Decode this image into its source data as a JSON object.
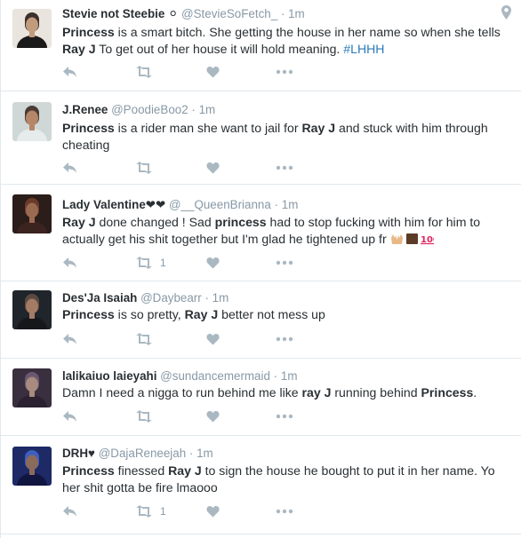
{
  "tweets": [
    {
      "name": "Stevie not Steebie ⚪",
      "handle": "@StevieSoFetch_",
      "dot": "·",
      "time": "1m",
      "segments": [
        {
          "t": "Princess",
          "b": true
        },
        {
          "t": " is a smart bitch. She getting the house in her name so when she tells "
        },
        {
          "t": "Ray J",
          "b": true
        },
        {
          "t": " To get out of her house it will hold meaning. "
        },
        {
          "t": "#LHHH",
          "h": true
        }
      ],
      "retweets": "",
      "has_location": true
    },
    {
      "name": "J.Renee",
      "handle": "@PoodieBoo2",
      "dot": "·",
      "time": "1m",
      "segments": [
        {
          "t": "Princess",
          "b": true
        },
        {
          "t": " is a rider man she want to jail for "
        },
        {
          "t": "Ray J",
          "b": true
        },
        {
          "t": " and stuck with him through cheating"
        }
      ],
      "retweets": ""
    },
    {
      "name": "Lady Valentine❤❤",
      "handle": "@__QueenBrianna",
      "dot": "·",
      "time": "1m",
      "segments": [
        {
          "t": "Ray J",
          "b": true
        },
        {
          "t": " done changed ! Sad "
        },
        {
          "t": "princess",
          "b": true
        },
        {
          "t": " had to stop fucking with him for him to actually get his shit together but I'm glad he tightened up fr "
        }
      ],
      "emoji": [
        "raised-hands-emoji",
        "brown-square-emoji",
        "hundred-points-emoji"
      ],
      "retweets": "1"
    },
    {
      "name": "Des'Ja Isaiah",
      "handle": "@Daybearr",
      "dot": "·",
      "time": "1m",
      "segments": [
        {
          "t": "Princess",
          "b": true
        },
        {
          "t": " is so pretty, "
        },
        {
          "t": "Ray J",
          "b": true
        },
        {
          "t": " better not mess up"
        }
      ],
      "retweets": ""
    },
    {
      "name": "lalikaiuo laieyahi",
      "handle": "@sundancemermaid",
      "dot": "·",
      "time": "1m",
      "segments": [
        {
          "t": "Damn I need a nigga to run behind me like "
        },
        {
          "t": "ray J",
          "b": true
        },
        {
          "t": " running behind "
        },
        {
          "t": "Princess",
          "b": true
        },
        {
          "t": "."
        }
      ],
      "retweets": ""
    },
    {
      "name": "DRH♥",
      "handle": "@DajaReneejah",
      "dot": "·",
      "time": "1m",
      "segments": [
        {
          "t": "Princess",
          "b": true
        },
        {
          "t": " finessed "
        },
        {
          "t": "Ray J",
          "b": true
        },
        {
          "t": " to sign the house he bought to put it in her name. Yo her shit gotta be fire lmaooo"
        }
      ],
      "retweets": "1"
    }
  ],
  "icons": {
    "reply": "reply-icon",
    "retweet": "retweet-icon",
    "like": "heart-icon",
    "more": "more-icon",
    "location": "location-pin-icon"
  },
  "colors": {
    "name": "#292f33",
    "meta": "#8899a6",
    "hashtag": "#2b7bb9",
    "action_icon": "#aab8c2",
    "divider": "#e1e8ed"
  }
}
